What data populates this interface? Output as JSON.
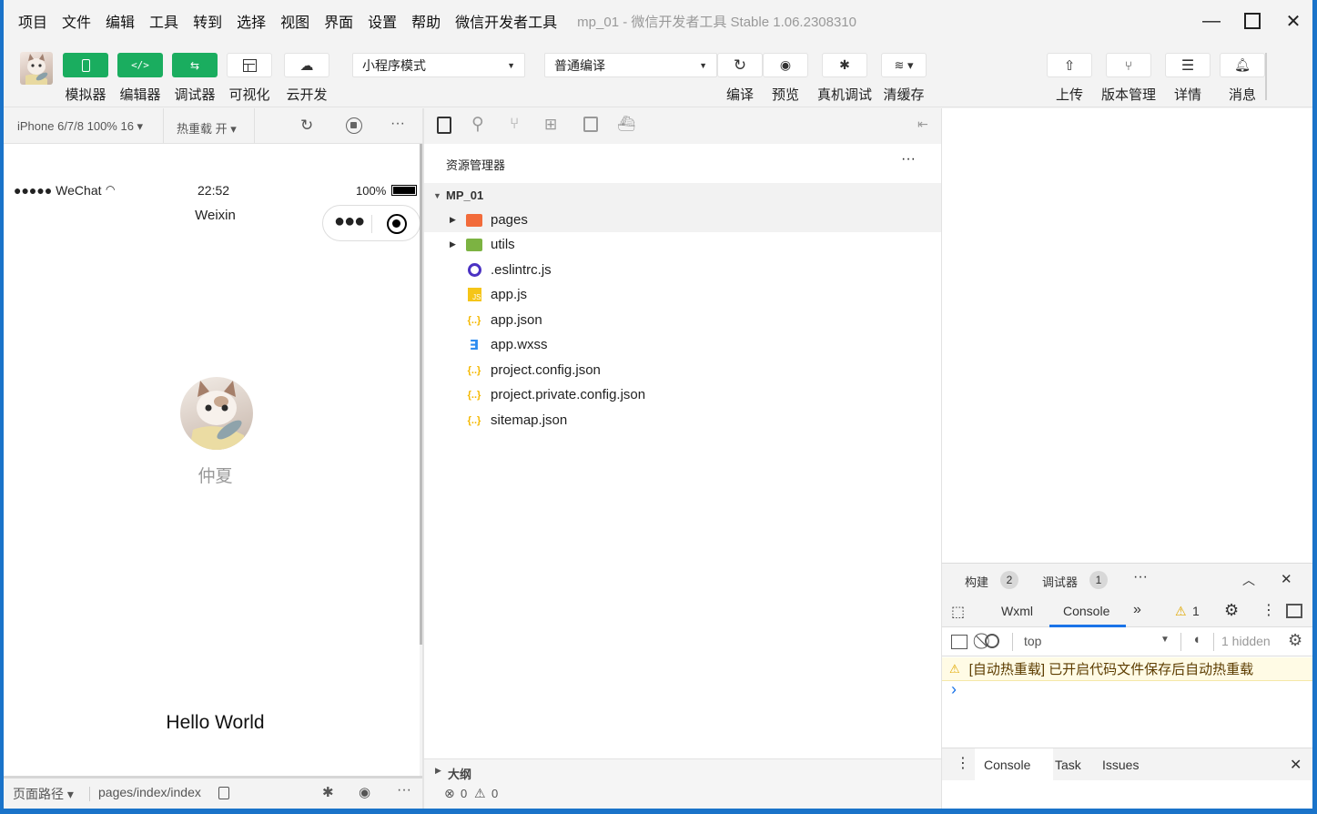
{
  "menu": [
    "项目",
    "文件",
    "编辑",
    "工具",
    "转到",
    "选择",
    "视图",
    "界面",
    "设置",
    "帮助",
    "微信开发者工具"
  ],
  "window_title": "mp_01 - 微信开发者工具 Stable 1.06.2308310",
  "toolbar": {
    "simulator": "模拟器",
    "editor": "编辑器",
    "debugger": "调试器",
    "visual": "可视化",
    "cloud": "云开发",
    "mode_select": "小程序模式",
    "compile_select": "普通编译",
    "compile": "编译",
    "preview": "预览",
    "real_debug": "真机调试",
    "clear_cache": "清缓存",
    "upload": "上传",
    "version": "版本管理",
    "details": "详情",
    "messages": "消息"
  },
  "simulator": {
    "device": "iPhone 6/7/8 100% 16 ▾",
    "hot_reload": "热重载 开 ▾",
    "status_carrier": "●●●●● WeChat",
    "status_time": "22:52",
    "status_battery": "100%",
    "nav_title": "Weixin",
    "nickname": "仲夏",
    "hello": "Hello World",
    "footer_path_label": "页面路径 ▾",
    "footer_path": "pages/index/index"
  },
  "explorer": {
    "title": "资源管理器",
    "root": "MP_01",
    "items": [
      {
        "name": "pages",
        "type": "folder-red"
      },
      {
        "name": "utils",
        "type": "folder-green"
      },
      {
        "name": ".eslintrc.js",
        "type": "eslint"
      },
      {
        "name": "app.js",
        "type": "js"
      },
      {
        "name": "app.json",
        "type": "json"
      },
      {
        "name": "app.wxss",
        "type": "wxss"
      },
      {
        "name": "project.config.json",
        "type": "json"
      },
      {
        "name": "project.private.config.json",
        "type": "json"
      },
      {
        "name": "sitemap.json",
        "type": "json"
      }
    ],
    "outline": "大纲",
    "errors": "0",
    "warnings": "0"
  },
  "debugger": {
    "build_tab": "构建",
    "build_count": "2",
    "debug_tab": "调试器",
    "debug_count": "1",
    "tabs": [
      "Wxml",
      "Console"
    ],
    "active_tab": "Console",
    "warn_count": "1",
    "context": "top",
    "hidden": "1 hidden",
    "warning_message": "[自动热重载] 已开启代码文件保存后自动热重载",
    "prompt": "›",
    "bottom_tabs": [
      "Console",
      "Task",
      "Issues"
    ]
  },
  "colors": {
    "accent_green": "#1aad5f",
    "console_blue": "#1a73e8",
    "warn_bg": "#fffbe5"
  }
}
